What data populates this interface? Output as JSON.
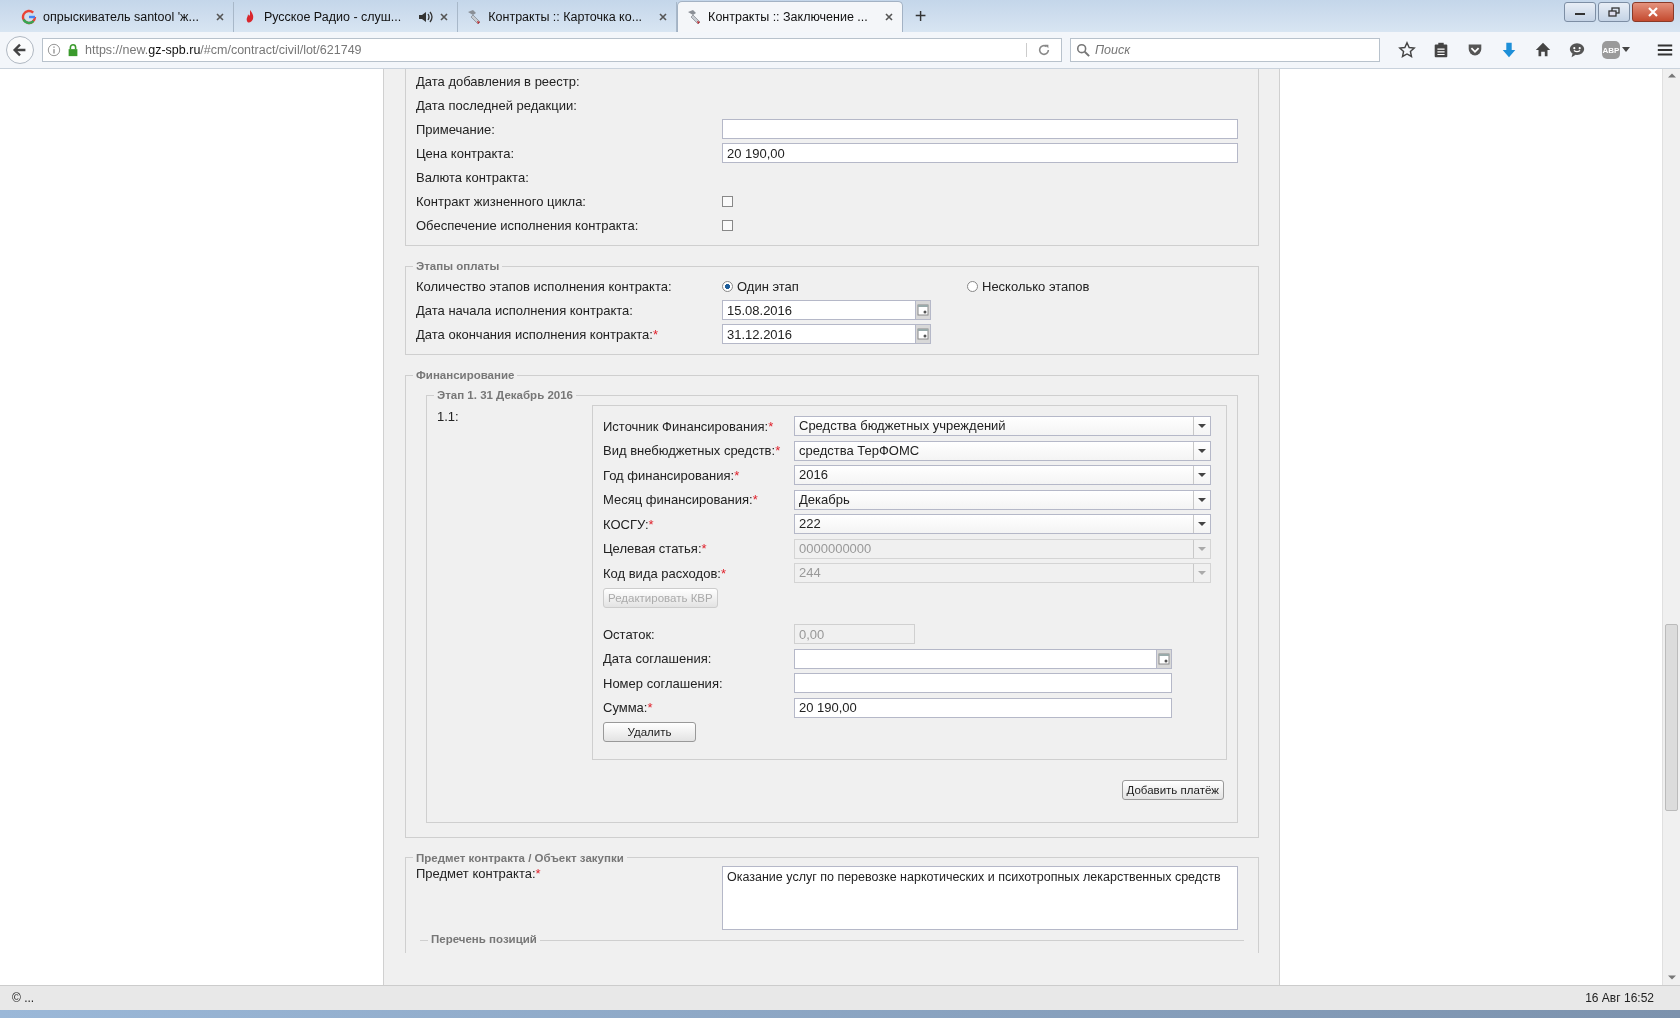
{
  "browser": {
    "tabs": [
      {
        "title": "опрыскиватель santool 'ж...",
        "kind": "google",
        "audio": false,
        "selected": false
      },
      {
        "title": "Русское Радио - слуш...",
        "kind": "flame",
        "audio": true,
        "selected": false
      },
      {
        "title": "Контракты :: Карточка ко...",
        "kind": "hammer",
        "audio": false,
        "selected": false
      },
      {
        "title": "Контракты :: Заключение ...",
        "kind": "hammer",
        "audio": false,
        "selected": true
      }
    ],
    "new_tab": "+",
    "url": {
      "prefix": "https://new.",
      "domain": "gz-spb.ru",
      "path": "/#cm/contract/civil/lot/621749"
    },
    "search": {
      "placeholder": "Поиск"
    },
    "abp_label": "ABP"
  },
  "general": {
    "rows": [
      {
        "kind": "text",
        "label": "Дата добавления в реестр:"
      },
      {
        "kind": "text",
        "label": "Дата последней редакции:"
      },
      {
        "kind": "input",
        "label": "Примечание:"
      },
      {
        "kind": "input",
        "label": "Цена контракта:",
        "value": "20 190,00"
      },
      {
        "kind": "text",
        "label": "Валюта контракта:"
      },
      {
        "kind": "checkbox",
        "label": "Контракт жизненного цикла:",
        "checked": false
      },
      {
        "kind": "checkbox",
        "label": "Обеспечение исполнения контракта:",
        "checked": false
      }
    ]
  },
  "payment_stages": {
    "legend": "Этапы оплаты",
    "count_label": "Количество этапов исполнения контракта:",
    "options": [
      {
        "label": "Один этап",
        "selected": true
      },
      {
        "label": "Несколько этапов",
        "selected": false
      }
    ],
    "dates": [
      {
        "label": "Дата начала исполнения контракта:",
        "value": "15.08.2016"
      },
      {
        "label": "Дата окончания исполнения контракта:",
        "mark": "*",
        "value": "31.12.2016"
      }
    ]
  },
  "financing": {
    "legend": "Финансирование",
    "stage": {
      "legend": "Этап 1. 31 Декабрь 2016",
      "number": "1.1:",
      "selects": [
        {
          "label": "Источник Финансирования:",
          "mark": "*",
          "value": "Средства бюджетных учреждений",
          "disabled": false
        },
        {
          "label": "Вид внебюджетных средств:",
          "mark": "*",
          "value": "средства ТерФОМС",
          "disabled": false
        },
        {
          "label": "Год финансирования:",
          "mark": "*",
          "value": "2016",
          "disabled": false
        },
        {
          "label": "Месяц финансирования:",
          "mark": "*",
          "value": "Декабрь",
          "disabled": false
        },
        {
          "label": "КОСГУ:",
          "mark": "*",
          "value": "222",
          "disabled": false
        },
        {
          "label": "Целевая статья:",
          "mark": "*",
          "value": "0000000000",
          "disabled": true
        },
        {
          "label": "Код вида расходов:",
          "mark": "*",
          "value": "244",
          "disabled": true
        }
      ],
      "edit_button": {
        "label": "Редактировать КВР",
        "disabled": true
      },
      "fields": [
        {
          "kind": "short",
          "label": "Остаток:",
          "value": "0,00",
          "disabled": true
        },
        {
          "kind": "date",
          "label": "Дата соглашения:",
          "disabled": false
        },
        {
          "kind": "input",
          "label": "Номер соглашения:",
          "disabled": false
        },
        {
          "kind": "input",
          "label": "Сумма:",
          "mark": "*",
          "value": "20 190,00",
          "disabled": false
        }
      ],
      "delete_button": "Удалить"
    },
    "add_button": "Добавить платёж"
  },
  "subject": {
    "legend": "Предмет контракта / Объект закупки",
    "label": "Предмет контракта:",
    "mark": "*",
    "value": "Оказание услуг по перевозке наркотических и психотропных лекарственных средств",
    "positions_legend": "Перечень позиций"
  },
  "status_bar": {
    "left": "© ...",
    "right": "16 Авг 16:52"
  }
}
